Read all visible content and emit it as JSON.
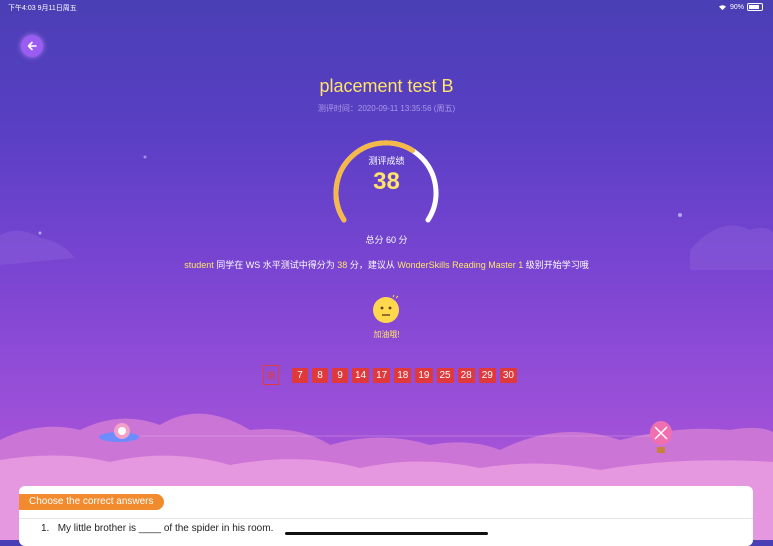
{
  "status_bar": {
    "time": "下午4:03   9月11日周五",
    "battery": "90%"
  },
  "header": {
    "title": "placement test B",
    "test_time": "测评时间：2020-09-11 13:35:56 (周五)"
  },
  "score": {
    "label": "测评成绩",
    "value": "38",
    "total": "总分 60 分",
    "fraction": 0.63
  },
  "summary": {
    "student": "student",
    "part1": " 同学在 WS 水平测试中得分为 ",
    "score": "38",
    "part2": " 分，建议从 ",
    "level": "WonderSkills Reading Master 1",
    "part3": " 级别开始学习哦"
  },
  "encouragement": "加油哦!",
  "wrong_icon": "错",
  "wrong_questions": [
    "7",
    "8",
    "9",
    "14",
    "17",
    "18",
    "19",
    "25",
    "28",
    "29",
    "30"
  ],
  "colors": {
    "accent": "#ffe36b",
    "wrong": "#e0393b",
    "tag": "#f28a2e"
  },
  "section": {
    "tag": "Choose the correct answers",
    "question_number": "1.",
    "question_text": "My little brother is ____   of the spider in his room."
  }
}
